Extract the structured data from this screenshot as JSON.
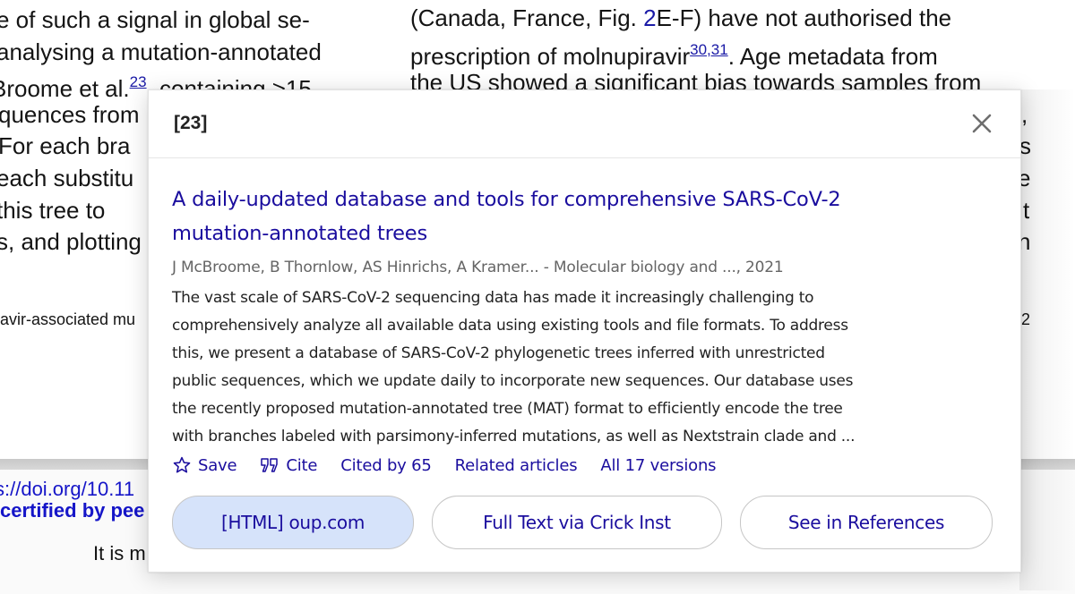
{
  "paper": {
    "left_column": [
      "e of such a signal in global se-",
      " analysing a mutation-annotated",
      "Broome et al.",
      "quences from",
      "For each bra",
      " each substitu",
      " this tree to",
      "s, and plotting"
    ],
    "left_line3_cite": "23",
    "left_line3_tail": ", containing >15",
    "left_caption": "avir-associated mu",
    "right_column": {
      "line1_pre": "(Canada, France, Fig. ",
      "line1_fig": "2",
      "line1_post": "E-F) have not authorised the",
      "line2_pre": "prescription of molnupiravir",
      "line2_cite": "30,31",
      "line2_post": ".  Age metadata from",
      "line3": "the US showed a significant bias towards samples from",
      "edge_fragments": [
        ",",
        "s",
        "e",
        "t",
        "n"
      ],
      "caption_fragment": "2"
    },
    "doi_text": "s://doi.org/10.11",
    "certified_text": "certified by pee",
    "body_text": "It is m"
  },
  "popup": {
    "reference_label": "[23]",
    "close_label": "close",
    "result": {
      "title_line1": "A daily-updated database and tools for comprehensive SARS-CoV-2",
      "title_line2": "mutation-annotated trees",
      "meta": "J McBroome, B Thornlow, AS Hinrichs, A Kramer... - Molecular biology and ..., 2021",
      "snippet": [
        "The vast scale of SARS-CoV-2 sequencing data has made it increasingly challenging to",
        "comprehensively analyze all available data using existing tools and file formats. To address",
        "this, we present a database of SARS-CoV-2 phylogenetic trees inferred with unrestricted",
        "public sequences, which we update daily to incorporate new sequences. Our database uses",
        "the recently proposed mutation-annotated tree (MAT) format to efficiently encode the tree",
        "with branches labeled with parsimony-inferred mutations, as well as Nextstrain clade and ..."
      ],
      "actions": {
        "save": "Save",
        "cite": "Cite",
        "cited_by": "Cited by 65",
        "related": "Related articles",
        "versions": "All 17 versions"
      }
    },
    "buttons": {
      "html": "[HTML] oup.com",
      "fulltext": "Full Text via Crick Inst",
      "references": "See in References"
    }
  },
  "colors": {
    "link": "#1a0d9e",
    "primary_button_bg": "#d6e3fa",
    "meta_gray": "#656565"
  }
}
